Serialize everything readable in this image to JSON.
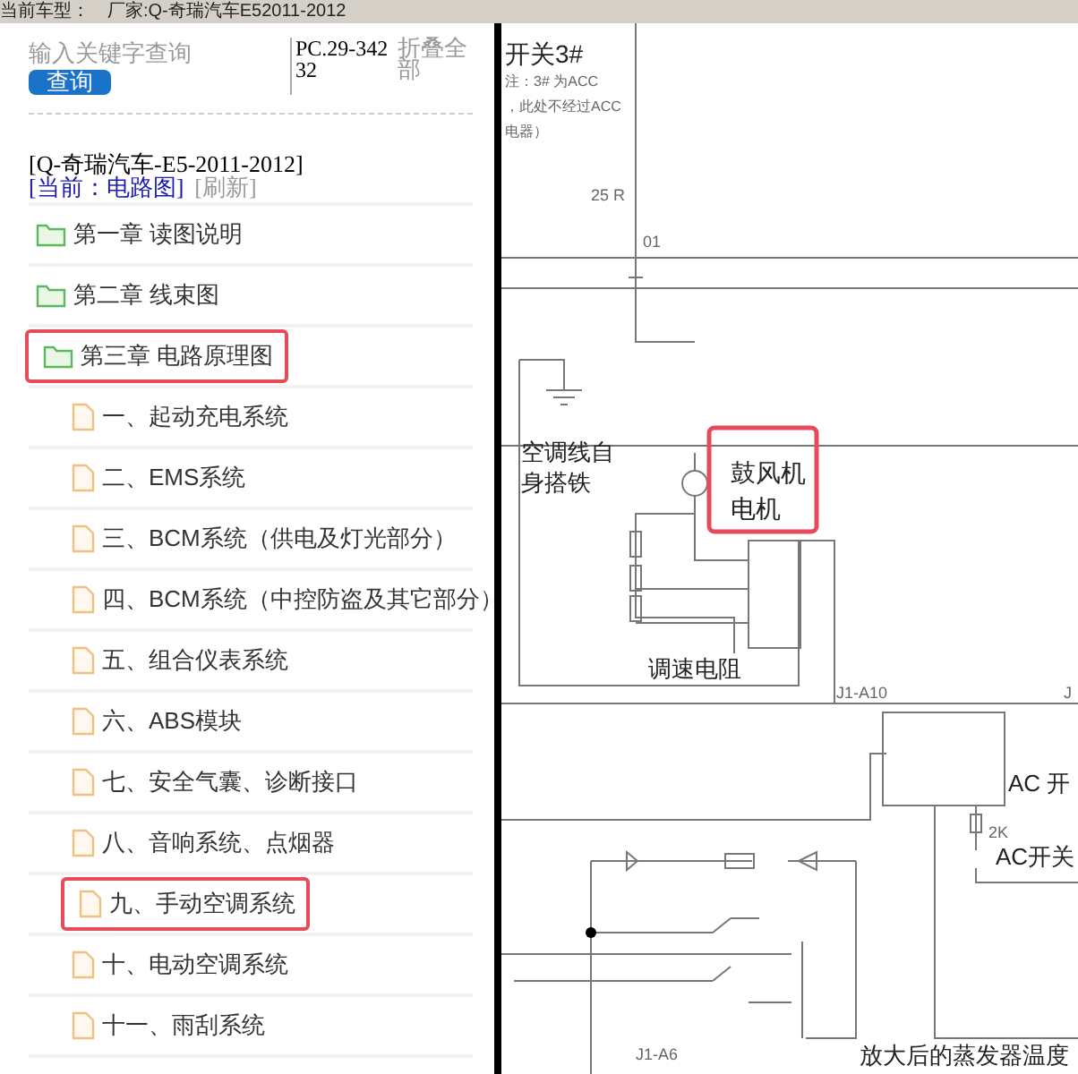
{
  "top_bar": {
    "label": "当前车型：",
    "value": "厂家:Q-奇瑞汽车E52011-2012"
  },
  "search": {
    "placeholder": "输入关键字查询",
    "button": "查询"
  },
  "part_number": "PC.29-34232",
  "collapse_all": "折叠全部",
  "vehicle": "[Q-奇瑞汽车-E5-2011-2012]",
  "current": "[当前：电路图]",
  "refresh": "[刷新]",
  "tree": [
    {
      "label": "第一章 读图说明",
      "kind": "folder",
      "highlighted": false
    },
    {
      "label": "第二章 线束图",
      "kind": "folder",
      "highlighted": false
    },
    {
      "label": "第三章 电路原理图",
      "kind": "folder",
      "highlighted": true,
      "children": [
        {
          "label": "一、起动充电系统",
          "kind": "file",
          "highlighted": false
        },
        {
          "label": "二、EMS系统",
          "kind": "file",
          "highlighted": false
        },
        {
          "label": "三、BCM系统（供电及灯光部分）",
          "kind": "file",
          "highlighted": false
        },
        {
          "label": "四、BCM系统（中控防盗及其它部分）",
          "kind": "file",
          "highlighted": false
        },
        {
          "label": "五、组合仪表系统",
          "kind": "file",
          "highlighted": false
        },
        {
          "label": "六、ABS模块",
          "kind": "file",
          "highlighted": false
        },
        {
          "label": "七、安全气囊、诊断接口",
          "kind": "file",
          "highlighted": false
        },
        {
          "label": "八、音响系统、点烟器",
          "kind": "file",
          "highlighted": false
        },
        {
          "label": "九、手动空调系统",
          "kind": "file",
          "highlighted": true
        },
        {
          "label": "十、电动空调系统",
          "kind": "file",
          "highlighted": false
        },
        {
          "label": "十一、雨刮系统",
          "kind": "file",
          "highlighted": false
        }
      ]
    }
  ],
  "diagram": {
    "labels": [
      {
        "text": "开关3#",
        "kind": "title"
      },
      {
        "text": "注：3# 为ACC",
        "kind": "note"
      },
      {
        "text": "，此处不经过ACC",
        "kind": "note"
      },
      {
        "text": "电器）",
        "kind": "note"
      },
      {
        "text": "25 R",
        "kind": "wire"
      },
      {
        "text": "01",
        "kind": "wire"
      },
      {
        "text": "空调线自",
        "kind": "label"
      },
      {
        "text": "身搭铁",
        "kind": "label"
      },
      {
        "text": "调速电阻",
        "kind": "label"
      },
      {
        "text": "J1-A10",
        "kind": "wire"
      },
      {
        "text": "J",
        "kind": "wire"
      },
      {
        "text": "AC 开",
        "kind": "label"
      },
      {
        "text": "2K",
        "kind": "wire"
      },
      {
        "text": "AC开关",
        "kind": "label"
      },
      {
        "text": "J1-A6",
        "kind": "wire"
      },
      {
        "text": "放大后的蒸发器温度",
        "kind": "label"
      }
    ],
    "callout": [
      "鼓风机",
      "电机"
    ]
  }
}
